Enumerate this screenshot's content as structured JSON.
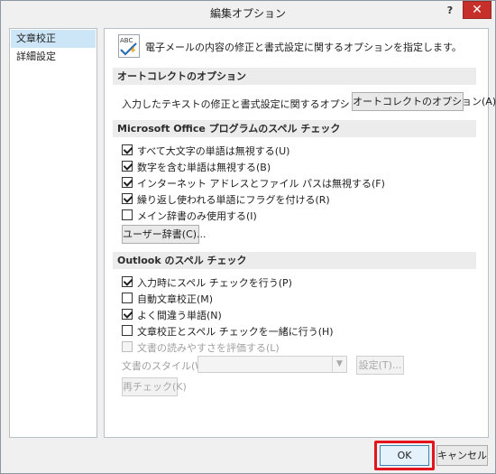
{
  "window": {
    "title": "編集オプション",
    "help_label": "?",
    "close_label": "✕"
  },
  "sidebar": {
    "items": [
      {
        "label": "文章校正",
        "selected": true
      },
      {
        "label": "詳細設定",
        "selected": false
      }
    ]
  },
  "main": {
    "icon_text": "ABC",
    "header_text": "電子メールの内容の修正と書式設定に関するオプションを指定します。",
    "autocorrect": {
      "section_title": "オートコレクトのオプション",
      "description": "入力したテキストの修正と書式設定に関するオプションを指定します。",
      "button_label": "オートコレクトのオプション(A)..."
    },
    "office_spell": {
      "section_title": "Microsoft Office プログラムのスペル チェック",
      "options": [
        {
          "label": "すべて大文字の単語は無視する(U)",
          "checked": true
        },
        {
          "label": "数字を含む単語は無視する(B)",
          "checked": true
        },
        {
          "label": "インターネット アドレスとファイル パスは無視する(F)",
          "checked": true
        },
        {
          "label": "繰り返し使われる単語にフラグを付ける(R)",
          "checked": true
        },
        {
          "label": "メイン辞書のみ使用する(I)",
          "checked": false
        }
      ],
      "dictionary_button": "ユーザー辞書(C)..."
    },
    "outlook_spell": {
      "section_title": "Outlook のスペル チェック",
      "options": [
        {
          "label": "入力時にスペル チェックを行う(P)",
          "checked": true,
          "disabled": false
        },
        {
          "label": "自動文章校正(M)",
          "checked": false,
          "disabled": false
        },
        {
          "label": "よく間違う単語(N)",
          "checked": true,
          "disabled": false
        },
        {
          "label": "文章校正とスペル チェックを一緒に行う(H)",
          "checked": false,
          "disabled": false
        },
        {
          "label": "文書の読みやすさを評価する(L)",
          "checked": false,
          "disabled": true
        }
      ],
      "style_label": "文書のスタイル(W):",
      "style_value": "",
      "settings_button": "設定(T)...",
      "recheck_button": "再チェック(K)"
    }
  },
  "footer": {
    "ok_label": "OK",
    "cancel_label": "キャンセル"
  },
  "colors": {
    "close_button": "#c7302a",
    "selection": "#cde6f7",
    "highlight_box": "#e3141d"
  }
}
